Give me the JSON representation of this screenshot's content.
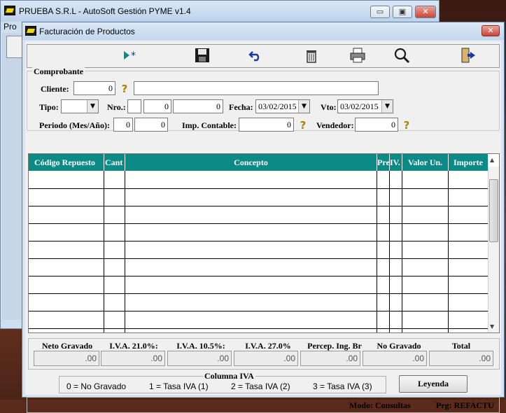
{
  "parent": {
    "title": "PRUEBA S.R.L - AutoSoft Gestión PYME v1.4",
    "menu_partial": "Pro",
    "minimize": "▭",
    "restore": "▣",
    "close": "✕"
  },
  "window": {
    "title": "Facturación de Productos",
    "close": "✕"
  },
  "toolbar": {
    "buttons": [
      "new-icon",
      "save-icon",
      "undo-icon",
      "delete-icon",
      "print-icon",
      "search-icon",
      "exit-icon"
    ]
  },
  "comprobante": {
    "legend": "Comprobante",
    "cliente_label": "Cliente:",
    "cliente_code": "0",
    "cliente_name": "",
    "tipo_label": "Tipo:",
    "tipo_value": "",
    "nro_label": "Nro.:",
    "nro_letter": "",
    "nro_pv": "0",
    "nro_num": "0",
    "fecha_label": "Fecha:",
    "fecha_value": "03/02/2015",
    "vto_label": "Vto:",
    "vto_value": "03/02/2015",
    "periodo_label": "Periodo (Mes/Año):",
    "periodo_mes": "0",
    "periodo_anio": "0",
    "imp_label": "Imp. Contable:",
    "imp_value": "0",
    "vendedor_label": "Vendedor:",
    "vendedor_value": "0"
  },
  "grid": {
    "columns": [
      "Código Repuesto",
      "Cant",
      "Concepto",
      "Pre",
      "IV.",
      "Valor Un.",
      "Importe"
    ],
    "row_count": 9
  },
  "totals": {
    "labels": [
      "Neto Gravado",
      "I.V.A. 21.0%:",
      "I.V.A. 10.5%:",
      "I.V.A. 27.0%",
      "Percep. Ing. Br",
      "No Gravado",
      "Total"
    ],
    "values": [
      ".00",
      ".00",
      ".00",
      ".00",
      ".00",
      ".00",
      ".00"
    ]
  },
  "iva": {
    "legend": "Columna IVA",
    "items": [
      "0 = No Gravado",
      "1 = Tasa IVA (1)",
      "2 = Tasa IVA (2)",
      "3 = Tasa IVA (3)"
    ],
    "leyenda_button": "Leyenda"
  },
  "status": {
    "modo": "Modo: Consultas",
    "prg": "Prg: REFACTU"
  }
}
